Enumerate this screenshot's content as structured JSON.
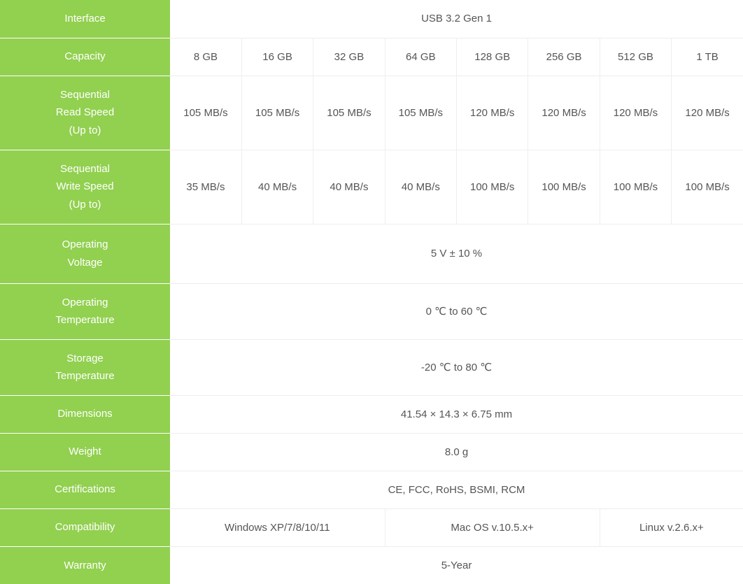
{
  "rows": {
    "interface": {
      "label": "Interface",
      "value": "USB 3.2 Gen 1"
    },
    "capacity": {
      "label": "Capacity",
      "values": [
        "8 GB",
        "16 GB",
        "32 GB",
        "64 GB",
        "128 GB",
        "256 GB",
        "512 GB",
        "1 TB"
      ]
    },
    "read_speed": {
      "label": "Sequential\nRead Speed\n(Up to)",
      "values": [
        "105 MB/s",
        "105 MB/s",
        "105 MB/s",
        "105 MB/s",
        "120 MB/s",
        "120 MB/s",
        "120 MB/s",
        "120 MB/s"
      ]
    },
    "write_speed": {
      "label": "Sequential\nWrite Speed\n(Up to)",
      "values": [
        "35 MB/s",
        "40 MB/s",
        "40 MB/s",
        "40 MB/s",
        "100 MB/s",
        "100 MB/s",
        "100 MB/s",
        "100 MB/s"
      ]
    },
    "operating_voltage": {
      "label": "Operating\nVoltage",
      "value": "5 V ± 10 %"
    },
    "operating_temperature": {
      "label": "Operating\nTemperature",
      "value": "0 ℃ to 60 ℃"
    },
    "storage_temperature": {
      "label": "Storage\nTemperature",
      "value": "-20 ℃ to 80 ℃"
    },
    "dimensions": {
      "label": "Dimensions",
      "value": "41.54 × 14.3 × 6.75 mm"
    },
    "weight": {
      "label": "Weight",
      "value": "8.0 g"
    },
    "certifications": {
      "label": "Certifications",
      "value": "CE, FCC, RoHS, BSMI, RCM"
    },
    "compatibility": {
      "label": "Compatibility",
      "values": [
        "Windows XP/7/8/10/11",
        "Mac OS v.10.5.x+",
        "Linux v.2.6.x+"
      ]
    },
    "warranty": {
      "label": "Warranty",
      "value": "5-Year"
    }
  },
  "colors": {
    "label_background": "#92d050",
    "label_text": "#ffffff",
    "value_text": "#555555",
    "grid_line": "#eeeeee"
  }
}
